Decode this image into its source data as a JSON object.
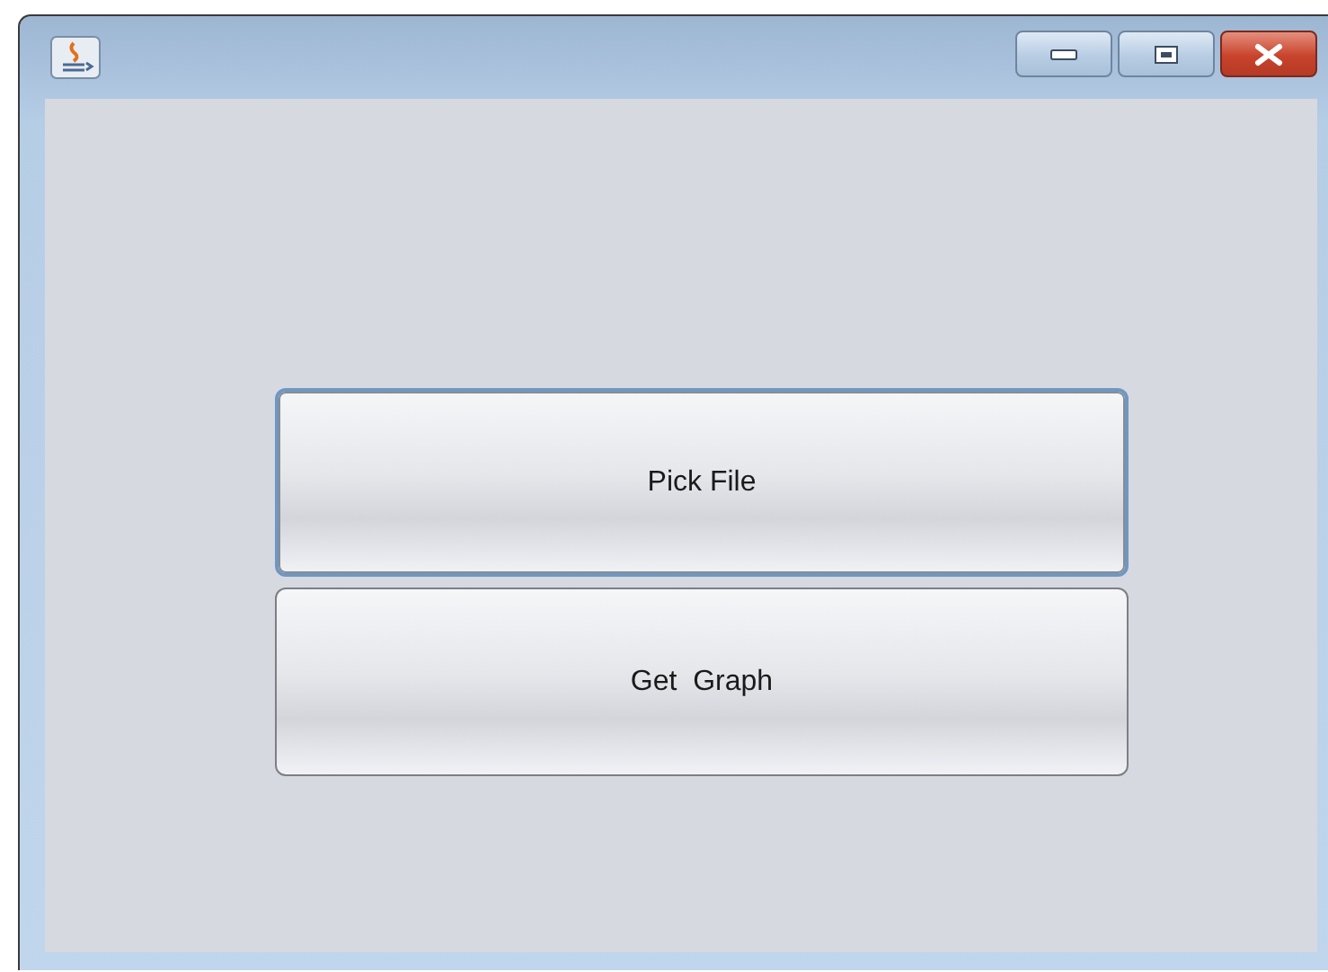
{
  "buttons": [
    {
      "label": "Pick File",
      "focused": true
    },
    {
      "label": "Get  Graph",
      "focused": false
    }
  ]
}
